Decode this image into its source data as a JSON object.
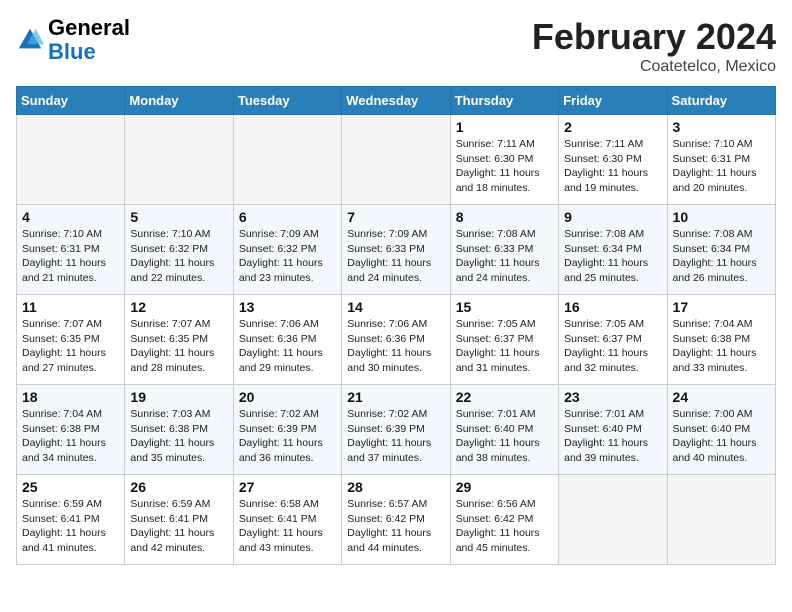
{
  "header": {
    "logo_general": "General",
    "logo_blue": "Blue",
    "month_year": "February 2024",
    "location": "Coatetelco, Mexico"
  },
  "days_of_week": [
    "Sunday",
    "Monday",
    "Tuesday",
    "Wednesday",
    "Thursday",
    "Friday",
    "Saturday"
  ],
  "weeks": [
    [
      {
        "day": "",
        "info": ""
      },
      {
        "day": "",
        "info": ""
      },
      {
        "day": "",
        "info": ""
      },
      {
        "day": "",
        "info": ""
      },
      {
        "day": "1",
        "info": "Sunrise: 7:11 AM\nSunset: 6:30 PM\nDaylight: 11 hours and 18 minutes."
      },
      {
        "day": "2",
        "info": "Sunrise: 7:11 AM\nSunset: 6:30 PM\nDaylight: 11 hours and 19 minutes."
      },
      {
        "day": "3",
        "info": "Sunrise: 7:10 AM\nSunset: 6:31 PM\nDaylight: 11 hours and 20 minutes."
      }
    ],
    [
      {
        "day": "4",
        "info": "Sunrise: 7:10 AM\nSunset: 6:31 PM\nDaylight: 11 hours and 21 minutes."
      },
      {
        "day": "5",
        "info": "Sunrise: 7:10 AM\nSunset: 6:32 PM\nDaylight: 11 hours and 22 minutes."
      },
      {
        "day": "6",
        "info": "Sunrise: 7:09 AM\nSunset: 6:32 PM\nDaylight: 11 hours and 23 minutes."
      },
      {
        "day": "7",
        "info": "Sunrise: 7:09 AM\nSunset: 6:33 PM\nDaylight: 11 hours and 24 minutes."
      },
      {
        "day": "8",
        "info": "Sunrise: 7:08 AM\nSunset: 6:33 PM\nDaylight: 11 hours and 24 minutes."
      },
      {
        "day": "9",
        "info": "Sunrise: 7:08 AM\nSunset: 6:34 PM\nDaylight: 11 hours and 25 minutes."
      },
      {
        "day": "10",
        "info": "Sunrise: 7:08 AM\nSunset: 6:34 PM\nDaylight: 11 hours and 26 minutes."
      }
    ],
    [
      {
        "day": "11",
        "info": "Sunrise: 7:07 AM\nSunset: 6:35 PM\nDaylight: 11 hours and 27 minutes."
      },
      {
        "day": "12",
        "info": "Sunrise: 7:07 AM\nSunset: 6:35 PM\nDaylight: 11 hours and 28 minutes."
      },
      {
        "day": "13",
        "info": "Sunrise: 7:06 AM\nSunset: 6:36 PM\nDaylight: 11 hours and 29 minutes."
      },
      {
        "day": "14",
        "info": "Sunrise: 7:06 AM\nSunset: 6:36 PM\nDaylight: 11 hours and 30 minutes."
      },
      {
        "day": "15",
        "info": "Sunrise: 7:05 AM\nSunset: 6:37 PM\nDaylight: 11 hours and 31 minutes."
      },
      {
        "day": "16",
        "info": "Sunrise: 7:05 AM\nSunset: 6:37 PM\nDaylight: 11 hours and 32 minutes."
      },
      {
        "day": "17",
        "info": "Sunrise: 7:04 AM\nSunset: 6:38 PM\nDaylight: 11 hours and 33 minutes."
      }
    ],
    [
      {
        "day": "18",
        "info": "Sunrise: 7:04 AM\nSunset: 6:38 PM\nDaylight: 11 hours and 34 minutes."
      },
      {
        "day": "19",
        "info": "Sunrise: 7:03 AM\nSunset: 6:38 PM\nDaylight: 11 hours and 35 minutes."
      },
      {
        "day": "20",
        "info": "Sunrise: 7:02 AM\nSunset: 6:39 PM\nDaylight: 11 hours and 36 minutes."
      },
      {
        "day": "21",
        "info": "Sunrise: 7:02 AM\nSunset: 6:39 PM\nDaylight: 11 hours and 37 minutes."
      },
      {
        "day": "22",
        "info": "Sunrise: 7:01 AM\nSunset: 6:40 PM\nDaylight: 11 hours and 38 minutes."
      },
      {
        "day": "23",
        "info": "Sunrise: 7:01 AM\nSunset: 6:40 PM\nDaylight: 11 hours and 39 minutes."
      },
      {
        "day": "24",
        "info": "Sunrise: 7:00 AM\nSunset: 6:40 PM\nDaylight: 11 hours and 40 minutes."
      }
    ],
    [
      {
        "day": "25",
        "info": "Sunrise: 6:59 AM\nSunset: 6:41 PM\nDaylight: 11 hours and 41 minutes."
      },
      {
        "day": "26",
        "info": "Sunrise: 6:59 AM\nSunset: 6:41 PM\nDaylight: 11 hours and 42 minutes."
      },
      {
        "day": "27",
        "info": "Sunrise: 6:58 AM\nSunset: 6:41 PM\nDaylight: 11 hours and 43 minutes."
      },
      {
        "day": "28",
        "info": "Sunrise: 6:57 AM\nSunset: 6:42 PM\nDaylight: 11 hours and 44 minutes."
      },
      {
        "day": "29",
        "info": "Sunrise: 6:56 AM\nSunset: 6:42 PM\nDaylight: 11 hours and 45 minutes."
      },
      {
        "day": "",
        "info": ""
      },
      {
        "day": "",
        "info": ""
      }
    ]
  ]
}
